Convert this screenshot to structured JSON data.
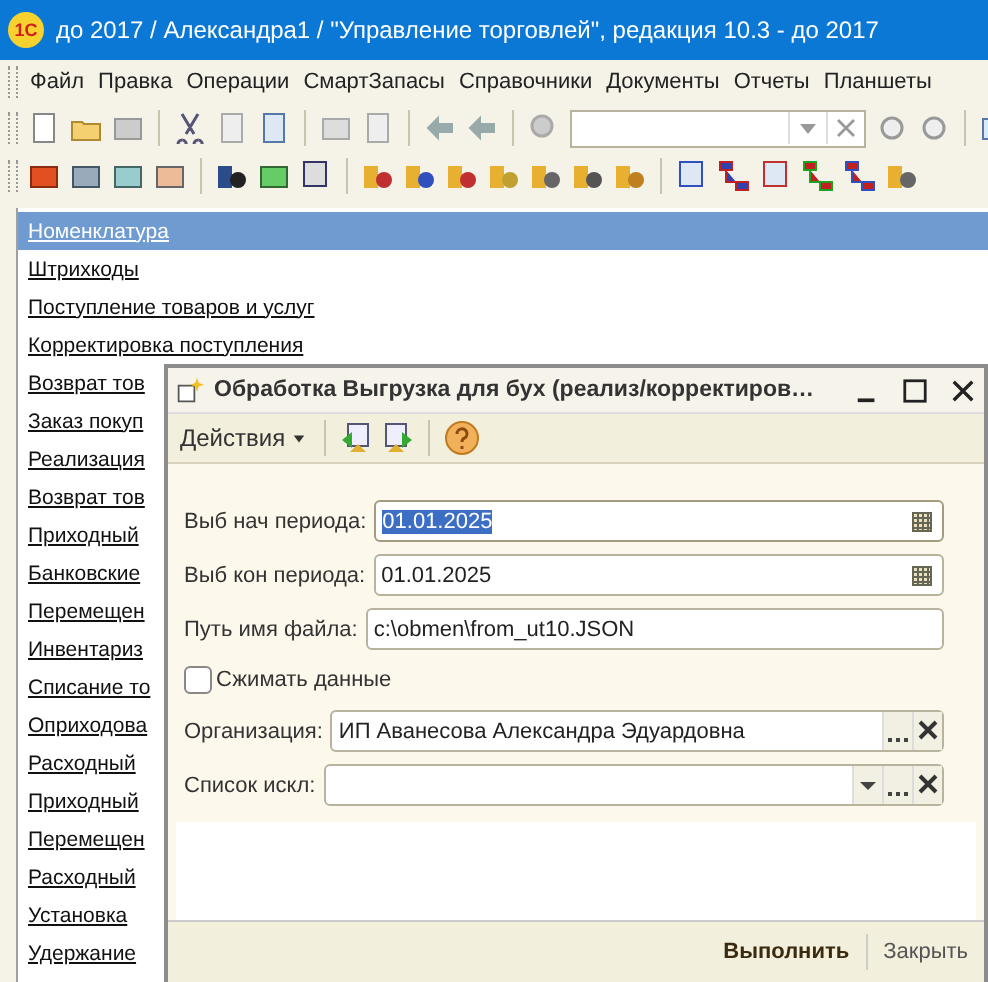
{
  "window": {
    "logo": "1С",
    "title": "до 2017 / Александра1 / \"Управление торговлей\", редакция 10.3 - до 2017"
  },
  "menu": [
    "Файл",
    "Правка",
    "Операции",
    "СмартЗапасы",
    "Справочники",
    "Документы",
    "Отчеты",
    "Планшеты"
  ],
  "list": {
    "items": [
      {
        "label": "Номенклатура",
        "selected": true
      },
      {
        "label": "Штрихкоды",
        "selected": false
      },
      {
        "label": "Поступление товаров и услуг",
        "selected": false
      },
      {
        "label": "Корректировка поступления",
        "selected": false
      },
      {
        "label": "Возврат тов",
        "selected": false
      },
      {
        "label": "Заказ покуп",
        "selected": false
      },
      {
        "label": "Реализация",
        "selected": false
      },
      {
        "label": "Возврат тов",
        "selected": false
      },
      {
        "label": "Приходный",
        "selected": false
      },
      {
        "label": "Банковские",
        "selected": false
      },
      {
        "label": "Перемещен",
        "selected": false
      },
      {
        "label": "Инвентариз",
        "selected": false
      },
      {
        "label": "Списание то",
        "selected": false
      },
      {
        "label": "Оприходова",
        "selected": false
      },
      {
        "label": "Расходный",
        "selected": false
      },
      {
        "label": "Приходный",
        "selected": false
      },
      {
        "label": "Перемещен",
        "selected": false
      },
      {
        "label": "Расходный",
        "selected": false
      },
      {
        "label": "Установка",
        "selected": false
      },
      {
        "label": "Удержание",
        "selected": false
      }
    ]
  },
  "dialog": {
    "title": "Обработка  Выгрузка для бух (реализ/корректиров…",
    "actions_menu": "Действия",
    "fields": [
      {
        "kind": "date",
        "label": "Выб нач периода:",
        "value": "01.01.2025",
        "selected": true
      },
      {
        "kind": "date",
        "label": "Выб кон периода:",
        "value": "01.01.2025",
        "selected": false
      },
      {
        "kind": "text",
        "label": "Путь имя файла:",
        "value": "c:\\obmen\\from_ut10.JSON",
        "selected": false
      },
      {
        "kind": "checkbox",
        "label": "Сжимать данные",
        "checked": false
      },
      {
        "kind": "reference",
        "label": "Организация:",
        "value": "ИП Аванесова Александра Эдуардовна",
        "selected": false
      },
      {
        "kind": "select",
        "label": "Список искл:",
        "selected": false
      }
    ],
    "buttons": [
      {
        "label": "Выполнить",
        "default": true
      },
      {
        "label": "Закрыть",
        "default": false
      }
    ]
  }
}
